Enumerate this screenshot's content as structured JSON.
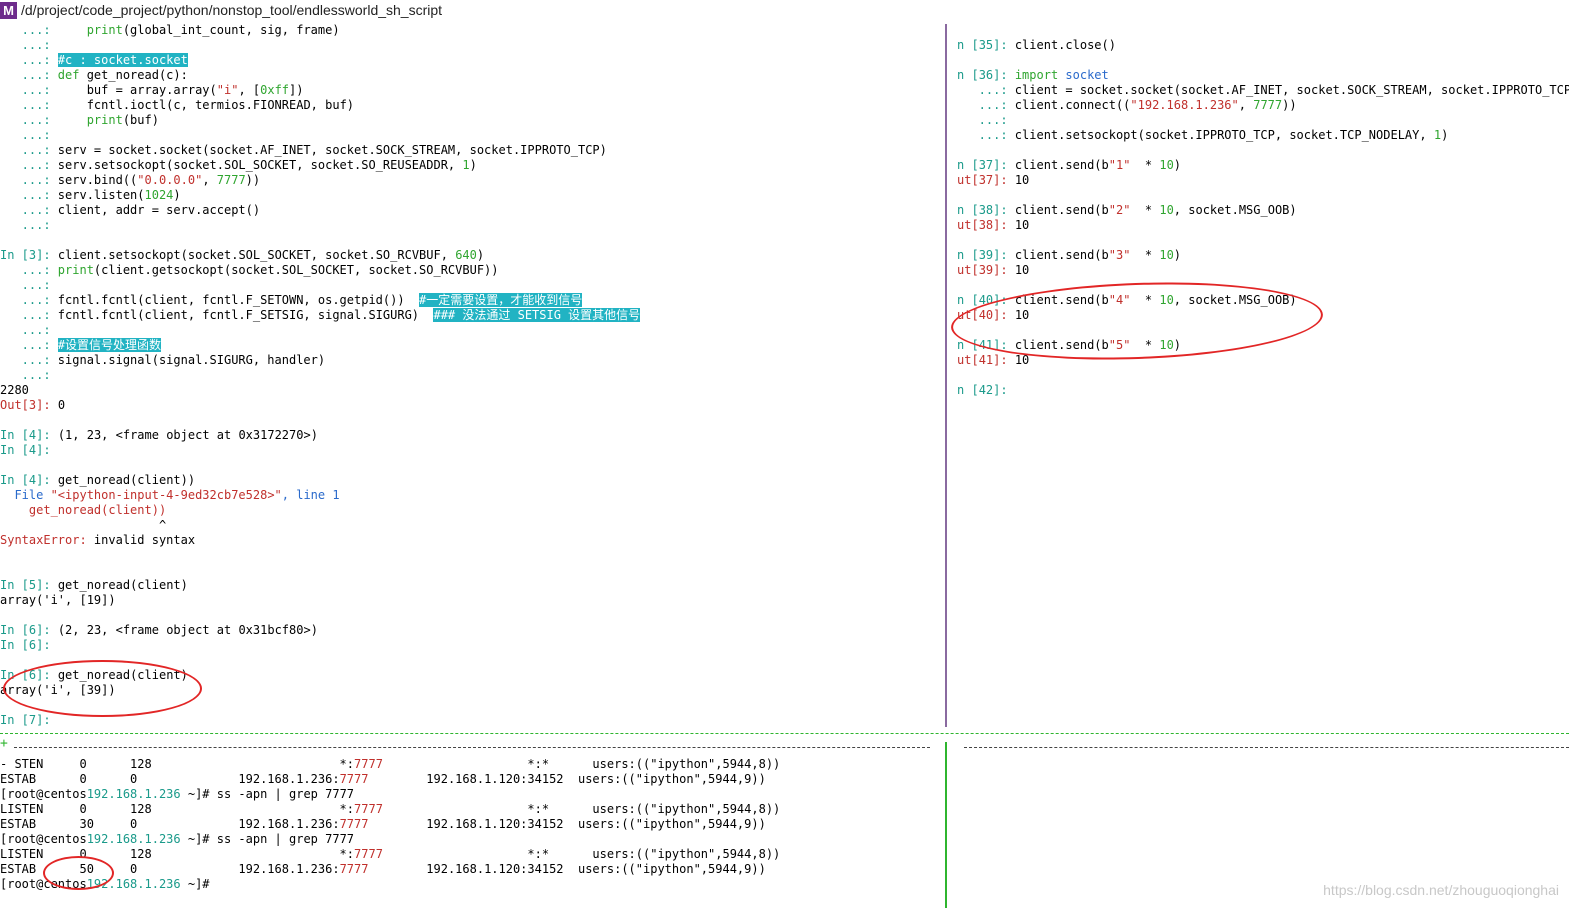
{
  "window": {
    "title": "/d/project/code_project/python/nonstop_tool/endlessworld_sh_script",
    "app_icon_label": "M"
  },
  "colors": {
    "prompt_in": "#1a9a8a",
    "prompt_out": "#c0302c",
    "keyword": "#2fa52f",
    "string": "#c0302c",
    "number": "#2fa52f",
    "highlight_bg": "#21b3c3",
    "highlight_fg": "#ffffff",
    "error": "#c0302c",
    "link": "#2a6acb",
    "port": "#c0302c",
    "host": "#1a9a8a",
    "annotation": "#e22626"
  },
  "left_pane": {
    "lines": [
      [
        [
          "   ...:     ",
          "c"
        ],
        [
          "print",
          "k"
        ],
        [
          "(global_int_count, sig, frame)",
          ""
        ]
      ],
      [
        [
          "   ...:",
          "c"
        ]
      ],
      [
        [
          "   ...: ",
          "c"
        ],
        [
          "#c : socket.socket",
          "h"
        ]
      ],
      [
        [
          "   ...: ",
          "c"
        ],
        [
          "def ",
          "k"
        ],
        [
          "get_noread",
          ""
        ],
        [
          "(c):",
          ""
        ]
      ],
      [
        [
          "   ...:     ",
          "c"
        ],
        [
          "buf = array.array(",
          ""
        ],
        [
          "\"i\"",
          "s"
        ],
        [
          ", [",
          ""
        ],
        [
          "0xff",
          "n"
        ],
        [
          "])",
          ""
        ]
      ],
      [
        [
          "   ...:     ",
          "c"
        ],
        [
          "fcntl.ioctl(c, termios.FIONREAD, buf)",
          ""
        ]
      ],
      [
        [
          "   ...:     ",
          "c"
        ],
        [
          "print",
          "k"
        ],
        [
          "(buf)",
          ""
        ]
      ],
      [
        [
          "   ...:",
          "c"
        ]
      ],
      [
        [
          "   ...: ",
          "c"
        ],
        [
          "serv = socket.socket(socket.AF_INET, socket.SOCK_STREAM, socket.IPPROTO_TCP)",
          ""
        ]
      ],
      [
        [
          "   ...: ",
          "c"
        ],
        [
          "serv.setsockopt(socket.SOL_SOCKET, socket.SO_REUSEADDR, ",
          ""
        ],
        [
          "1",
          "n"
        ],
        [
          ")",
          ""
        ]
      ],
      [
        [
          "   ...: ",
          "c"
        ],
        [
          "serv.bind((",
          ""
        ],
        [
          "\"0.0.0.0\"",
          "s"
        ],
        [
          ", ",
          ""
        ],
        [
          "7777",
          "n"
        ],
        [
          "))",
          ""
        ]
      ],
      [
        [
          "   ...: ",
          "c"
        ],
        [
          "serv.listen(",
          ""
        ],
        [
          "1024",
          "n"
        ],
        [
          ")",
          ""
        ]
      ],
      [
        [
          "   ...: ",
          "c"
        ],
        [
          "client, addr = serv.accept()",
          ""
        ]
      ],
      [
        [
          "   ...:",
          "c"
        ]
      ],
      [],
      [
        [
          "In [",
          "c"
        ],
        [
          "3",
          "c"
        ],
        [
          "]: ",
          "c"
        ],
        [
          "client.setsockopt(socket.SOL_SOCKET, socket.SO_RCVBUF, ",
          ""
        ],
        [
          "640",
          "n"
        ],
        [
          ")",
          ""
        ]
      ],
      [
        [
          "   ...: ",
          "c"
        ],
        [
          "print",
          "k"
        ],
        [
          "(client.getsockopt(socket.SOL_SOCKET, socket.SO_RCVBUF))",
          ""
        ]
      ],
      [
        [
          "   ...:",
          "c"
        ]
      ],
      [
        [
          "   ...: ",
          "c"
        ],
        [
          "fcntl.fcntl(client, fcntl.F_SETOWN, os.getpid())  ",
          ""
        ],
        [
          "#一定需要设置，才能收到信号",
          "h"
        ]
      ],
      [
        [
          "   ...: ",
          "c"
        ],
        [
          "fcntl.fcntl(client, fcntl.F_SETSIG, signal.SIGURG)  ",
          ""
        ],
        [
          "### 没法通过 SETSIG 设置其他信号",
          "h"
        ]
      ],
      [
        [
          "   ...:",
          "c"
        ]
      ],
      [
        [
          "   ...: ",
          "c"
        ],
        [
          "#设置信号处理函数",
          "h"
        ]
      ],
      [
        [
          "   ...: ",
          "c"
        ],
        [
          "signal.signal(signal.SIGURG, handler)",
          ""
        ]
      ],
      [
        [
          "   ...:",
          "c"
        ]
      ],
      [
        [
          "2280",
          ""
        ]
      ],
      [
        [
          "Out[",
          "o"
        ],
        [
          "3",
          "o"
        ],
        [
          "]: ",
          "o"
        ],
        [
          "0",
          ""
        ]
      ],
      [],
      [
        [
          "In [",
          "c"
        ],
        [
          "4",
          "c"
        ],
        [
          "]: ",
          "c"
        ],
        [
          "(1, 23, <frame object at 0x3172270>)",
          ""
        ]
      ],
      [
        [
          "In [",
          "c"
        ],
        [
          "4",
          "c"
        ],
        [
          "]:",
          "c"
        ]
      ],
      [],
      [
        [
          "In [",
          "c"
        ],
        [
          "4",
          "c"
        ],
        [
          "]: ",
          "c"
        ],
        [
          "get_noread(client))",
          ""
        ]
      ],
      [
        [
          "  File ",
          "l"
        ],
        [
          "\"<ipython-input-4-9ed32cb7e528>\"",
          "s"
        ],
        [
          ", line 1",
          "l"
        ]
      ],
      [
        [
          "    get_noread(client))",
          "e"
        ]
      ],
      [
        [
          "                      ^",
          ""
        ]
      ],
      [
        [
          "SyntaxError:",
          "e"
        ],
        [
          " invalid syntax",
          ""
        ]
      ],
      [],
      [],
      [
        [
          "In [",
          "c"
        ],
        [
          "5",
          "c"
        ],
        [
          "]: ",
          "c"
        ],
        [
          "get_noread(client)",
          ""
        ]
      ],
      [
        [
          "array('i', [19])",
          ""
        ]
      ],
      [],
      [
        [
          "In [",
          "c"
        ],
        [
          "6",
          "c"
        ],
        [
          "]: ",
          "c"
        ],
        [
          "(2, 23, <frame object at 0x31bcf80>)",
          ""
        ]
      ],
      [
        [
          "In [",
          "c"
        ],
        [
          "6",
          "c"
        ],
        [
          "]:",
          "c"
        ]
      ],
      [],
      [
        [
          "In [",
          "c"
        ],
        [
          "6",
          "c"
        ],
        [
          "]: ",
          "c"
        ],
        [
          "get_noread(client)",
          ""
        ]
      ],
      [
        [
          "array('i', [39])",
          ""
        ]
      ],
      [],
      [
        [
          "In [",
          "c"
        ],
        [
          "7",
          "c"
        ],
        [
          "]:",
          "c"
        ]
      ]
    ]
  },
  "right_pane": {
    "lines": [
      [],
      [
        [
          "n [",
          "c"
        ],
        [
          "35",
          "c"
        ],
        [
          "]: ",
          "c"
        ],
        [
          "client.close()",
          ""
        ]
      ],
      [],
      [
        [
          "n [",
          "c"
        ],
        [
          "36",
          "c"
        ],
        [
          "]: ",
          "c"
        ],
        [
          "import ",
          "k"
        ],
        [
          "socket",
          "l"
        ]
      ],
      [
        [
          "   ...: ",
          "c"
        ],
        [
          "client = socket.socket(socket.AF_INET, socket.SOCK_STREAM, socket.IPPROTO_TCP)",
          ""
        ]
      ],
      [
        [
          "   ...: ",
          "c"
        ],
        [
          "client.connect((",
          ""
        ],
        [
          "\"192.168.1.236\"",
          "s"
        ],
        [
          ", ",
          ""
        ],
        [
          "7777",
          "n"
        ],
        [
          "))",
          ""
        ]
      ],
      [
        [
          "   ...:",
          "c"
        ]
      ],
      [
        [
          "   ...: ",
          "c"
        ],
        [
          "client.setsockopt(socket.IPPROTO_TCP, socket.TCP_NODELAY, ",
          ""
        ],
        [
          "1",
          "n"
        ],
        [
          ")",
          ""
        ]
      ],
      [],
      [
        [
          "n [",
          "c"
        ],
        [
          "37",
          "c"
        ],
        [
          "]: ",
          "c"
        ],
        [
          "client.send(b",
          ""
        ],
        [
          "\"1\"",
          "s"
        ],
        [
          "  * ",
          ""
        ],
        [
          "10",
          "n"
        ],
        [
          ")",
          ""
        ]
      ],
      [
        [
          "ut[",
          "o"
        ],
        [
          "37",
          "o"
        ],
        [
          "]: ",
          "o"
        ],
        [
          "10",
          ""
        ]
      ],
      [],
      [
        [
          "n [",
          "c"
        ],
        [
          "38",
          "c"
        ],
        [
          "]: ",
          "c"
        ],
        [
          "client.send(b",
          ""
        ],
        [
          "\"2\"",
          "s"
        ],
        [
          "  * ",
          ""
        ],
        [
          "10",
          "n"
        ],
        [
          ", socket.MSG_OOB)",
          ""
        ]
      ],
      [
        [
          "ut[",
          "o"
        ],
        [
          "38",
          "o"
        ],
        [
          "]: ",
          "o"
        ],
        [
          "10",
          ""
        ]
      ],
      [],
      [
        [
          "n [",
          "c"
        ],
        [
          "39",
          "c"
        ],
        [
          "]: ",
          "c"
        ],
        [
          "client.send(b",
          ""
        ],
        [
          "\"3\"",
          "s"
        ],
        [
          "  * ",
          ""
        ],
        [
          "10",
          "n"
        ],
        [
          ")",
          ""
        ]
      ],
      [
        [
          "ut[",
          "o"
        ],
        [
          "39",
          "o"
        ],
        [
          "]: ",
          "o"
        ],
        [
          "10",
          ""
        ]
      ],
      [],
      [
        [
          "n [",
          "c"
        ],
        [
          "40",
          "c"
        ],
        [
          "]: ",
          "c"
        ],
        [
          "client.send(b",
          ""
        ],
        [
          "\"4\"",
          "s"
        ],
        [
          "  * ",
          ""
        ],
        [
          "10",
          "n"
        ],
        [
          ", socket.MSG_OOB)",
          ""
        ]
      ],
      [
        [
          "ut[",
          "o"
        ],
        [
          "40",
          "o"
        ],
        [
          "]: ",
          "o"
        ],
        [
          "10",
          ""
        ]
      ],
      [],
      [
        [
          "n [",
          "c"
        ],
        [
          "41",
          "c"
        ],
        [
          "]: ",
          "c"
        ],
        [
          "client.send(b",
          ""
        ],
        [
          "\"5\"",
          "s"
        ],
        [
          "  * ",
          ""
        ],
        [
          "10",
          "n"
        ],
        [
          ")",
          ""
        ]
      ],
      [
        [
          "ut[",
          "o"
        ],
        [
          "41",
          "o"
        ],
        [
          "]: ",
          "o"
        ],
        [
          "10",
          ""
        ]
      ],
      [],
      [
        [
          "n [",
          "c"
        ],
        [
          "42",
          "c"
        ],
        [
          "]:",
          "c"
        ]
      ]
    ]
  },
  "bottom_pane": {
    "lines": [
      [
        [
          "- STEN     0      128                          *:",
          ""
        ],
        [
          "7777",
          "p"
        ],
        [
          "                    *:*      users:((\"ipython\",5944,8))",
          ""
        ]
      ],
      [
        [
          "ESTAB      0      0              192.168.1.236:",
          ""
        ],
        [
          "7777",
          "p"
        ],
        [
          "        192.168.1.120:34152  users:((\"ipython\",5944,9))",
          ""
        ]
      ],
      [
        [
          "[root@centos",
          ""
        ],
        [
          "192.168.1.236",
          "t"
        ],
        [
          " ~]# ss -apn | grep 7777",
          ""
        ]
      ],
      [
        [
          "LISTEN     0      128                          *:",
          ""
        ],
        [
          "7777",
          "p"
        ],
        [
          "                    *:*      users:((\"ipython\",5944,8))",
          ""
        ]
      ],
      [
        [
          "ESTAB      30     0              192.168.1.236:",
          ""
        ],
        [
          "7777",
          "p"
        ],
        [
          "        192.168.1.120:34152  users:((\"ipython\",5944,9))",
          ""
        ]
      ],
      [
        [
          "[root@centos",
          ""
        ],
        [
          "192.168.1.236",
          "t"
        ],
        [
          " ~]# ss -apn | grep 7777",
          ""
        ]
      ],
      [
        [
          "LISTEN     0      128                          *:",
          ""
        ],
        [
          "7777",
          "p"
        ],
        [
          "                    *:*      users:((\"ipython\",5944,8))",
          ""
        ]
      ],
      [
        [
          "ESTAB      50     0              192.168.1.236:",
          ""
        ],
        [
          "7777",
          "p"
        ],
        [
          "        192.168.1.120:34152  users:((\"ipython\",5944,9))",
          ""
        ]
      ],
      [
        [
          "[root@centos",
          ""
        ],
        [
          "192.168.1.236",
          "t"
        ],
        [
          " ~]#",
          ""
        ]
      ]
    ]
  },
  "watermark": "https://blog.csdn.net/zhouguoqionghai"
}
